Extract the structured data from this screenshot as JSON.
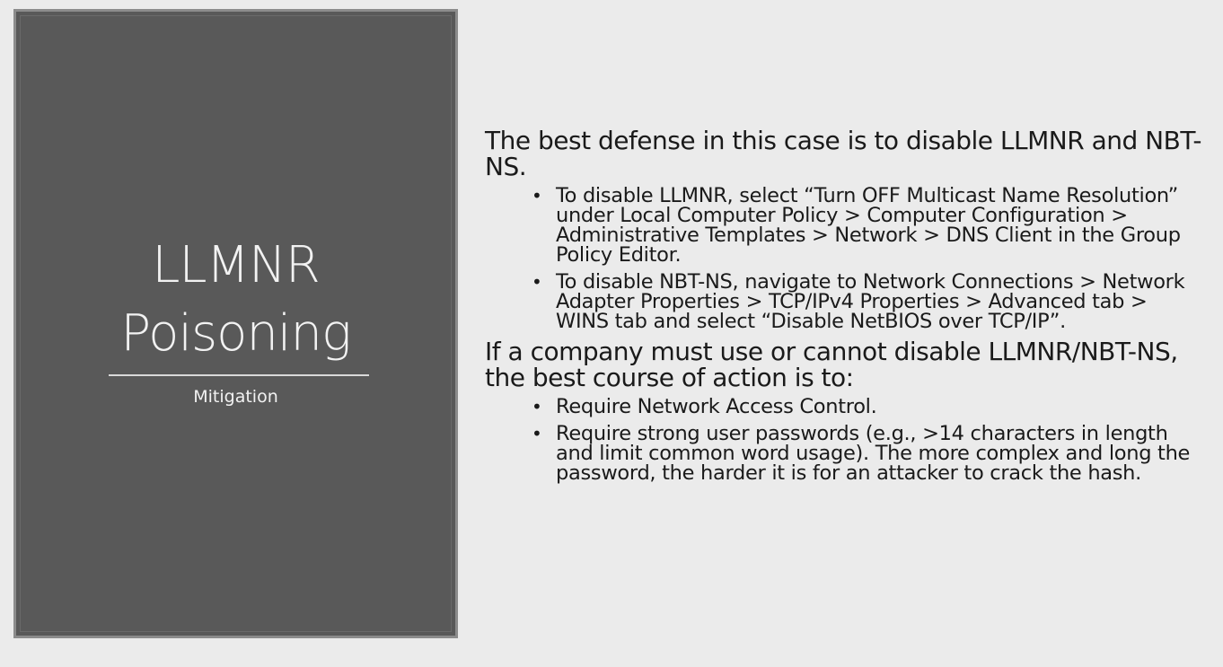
{
  "title_panel": {
    "title_line1": "LLMNR",
    "title_line2": "Poisoning",
    "subtitle": "Mitigation"
  },
  "content": {
    "point1": "The best defense in this case is to disable LLMNR and NBT-NS.",
    "point1_items": [
      "To disable LLMNR, select “Turn OFF Multicast Name Resolution” under Local Computer Policy > Computer Configuration > Administrative Templates > Network > DNS Client in the Group Policy Editor.",
      "To disable NBT-NS, navigate to Network Connections > Network Adapter Properties > TCP/IPv4 Properties > Advanced tab > WINS tab and select “Disable NetBIOS over TCP/IP”."
    ],
    "point2": "If a company must use or cannot disable LLMNR/NBT-NS, the best course of action is to:",
    "point2_items": [
      "Require Network Access Control.",
      "Require strong user passwords (e.g., >14 characters in length and limit common word usage).  The more complex and long the password, the harder it is for an attacker to crack the hash."
    ],
    "bullet_char": "•"
  }
}
